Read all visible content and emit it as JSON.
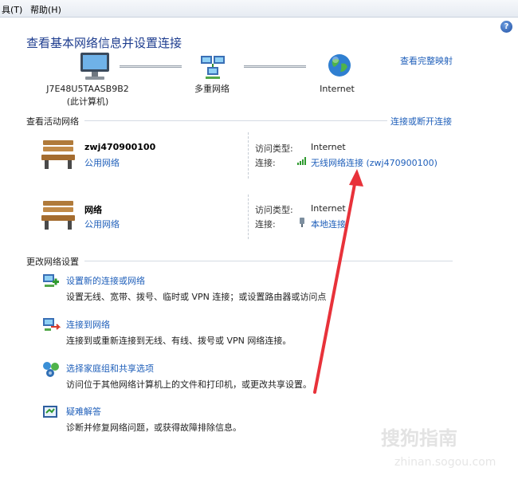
{
  "menu": {
    "tools": "具(T)",
    "help": "帮助(H)"
  },
  "header": {
    "title": "查看基本网络信息并设置连接",
    "full_map": "查看完整映射"
  },
  "map": {
    "computer_name": "J7E48U5TAASB9B2",
    "computer_sub": "(此计算机)",
    "middle": "多重网络",
    "internet": "Internet"
  },
  "active": {
    "heading": "查看活动网络",
    "connect_link": "连接或断开连接",
    "networks": [
      {
        "name": "zwj470900100",
        "category": "公用网络",
        "access_label": "访问类型:",
        "access_value": "Internet",
        "connection_label": "连接:",
        "connection_value": "无线网络连接 (zwj470900100)"
      },
      {
        "name": "网络",
        "category": "公用网络",
        "access_label": "访问类型:",
        "access_value": "Internet",
        "connection_label": "连接:",
        "connection_value": "本地连接"
      }
    ]
  },
  "settings": {
    "heading": "更改网络设置",
    "tasks": [
      {
        "title": "设置新的连接或网络",
        "desc": "设置无线、宽带、拨号、临时或 VPN 连接；或设置路由器或访问点",
        "icon": "new-connection-icon"
      },
      {
        "title": "连接到网络",
        "desc": "连接到或重新连接到无线、有线、拨号或 VPN 网络连接。",
        "icon": "connect-network-icon"
      },
      {
        "title": "选择家庭组和共享选项",
        "desc": "访问位于其他网络计算机上的文件和打印机，或更改共享设置。",
        "icon": "homegroup-icon"
      },
      {
        "title": "疑难解答",
        "desc": "诊断并修复网络问题，或获得故障排除信息。",
        "icon": "troubleshoot-icon"
      }
    ]
  },
  "watermark": {
    "main": "搜狗指南",
    "sub": "zhinan.sogou.com"
  },
  "colors": {
    "link": "#1f5fba",
    "title": "#1e3d8f",
    "annotation_arrow": "#e8323a"
  }
}
